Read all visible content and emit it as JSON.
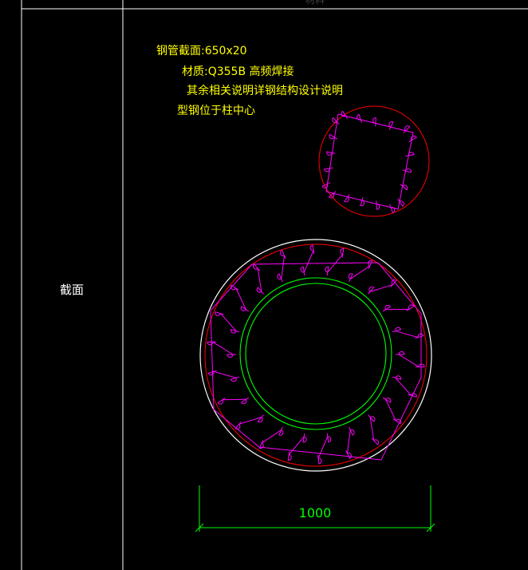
{
  "table": {
    "header_cut_text": "材料",
    "row_label": "截面"
  },
  "notes": {
    "line1": "钢管截面:650x20",
    "line2": "材质:Q355B   高频焊接",
    "line3": "其余相关说明详钢结构设计说明",
    "line4": "型钢位于柱中心"
  },
  "dimension": {
    "value": "1000"
  },
  "colors": {
    "background": "#000000",
    "grid": "#ffffff",
    "note_text": "#ffff00",
    "outer_circle": "#ffffff",
    "column_outline": "#ff0000",
    "rebar": "#ff00ff",
    "steel_pipe": "#00ff00",
    "dimension": "#00ff00",
    "header_text": "#444444"
  }
}
